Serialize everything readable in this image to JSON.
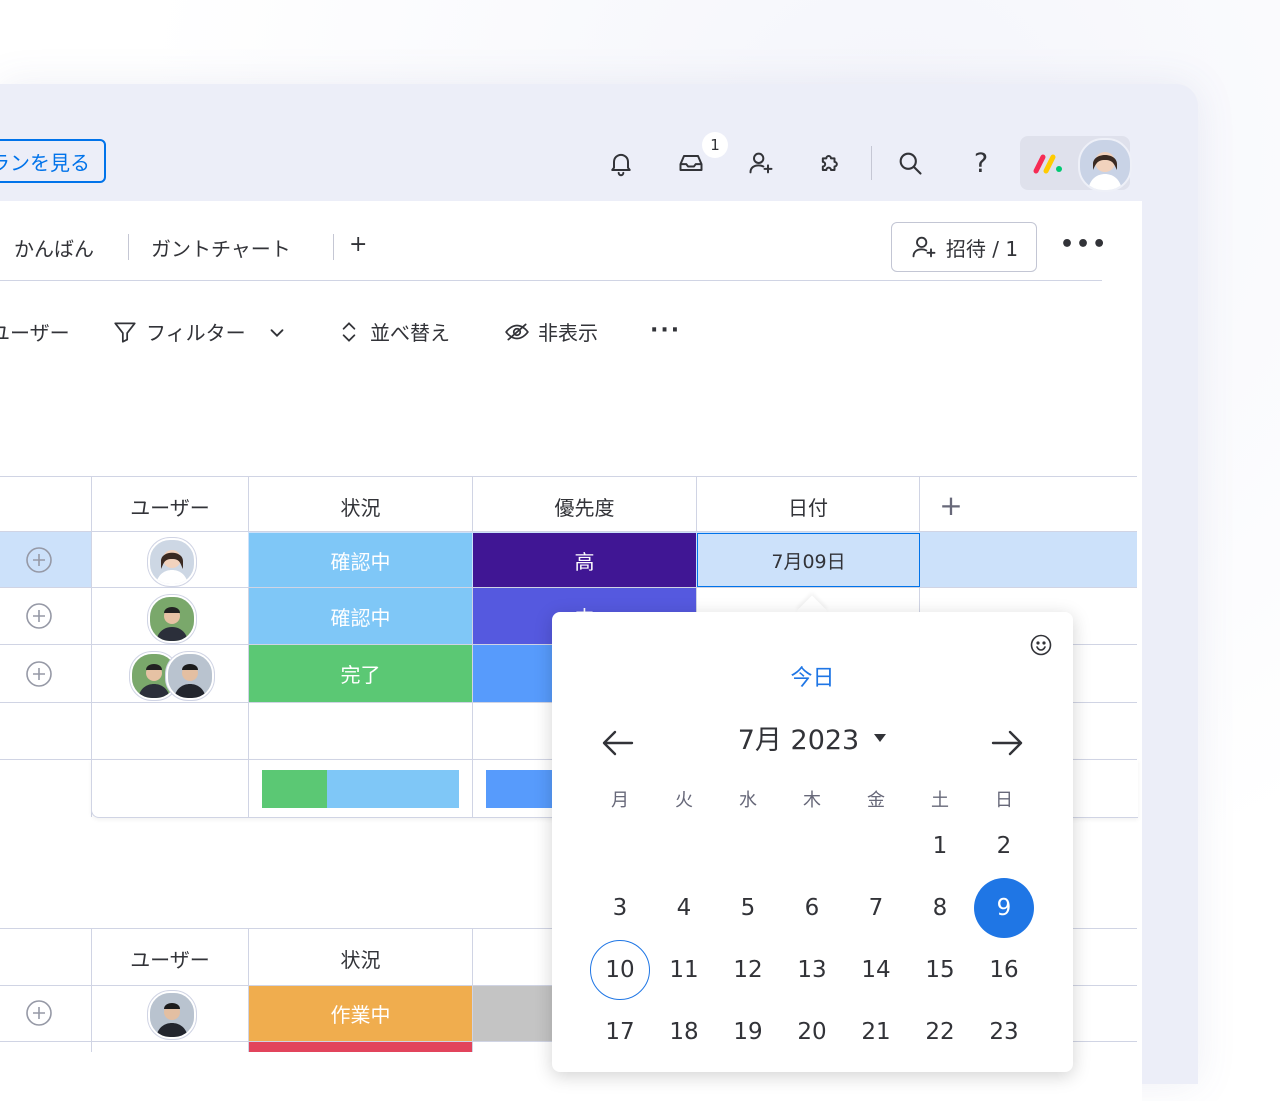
{
  "topbar": {
    "see_plans_label": "ランを見る",
    "notification_badge": "1",
    "icons": [
      "bell-icon",
      "inbox-icon",
      "invite-user-icon",
      "apps-puzzle-icon",
      "search-icon",
      "help-icon"
    ]
  },
  "tabs": {
    "items": [
      "かんばん",
      "ガントチャート",
      "+"
    ],
    "invite_label": "招待 / 1",
    "more": "•••"
  },
  "toolbar": {
    "user_label": "ユーザー",
    "filter_label": "フィルター",
    "sort_label": "並べ替え",
    "hide_label": "非表示",
    "more": "···"
  },
  "table1": {
    "headers": {
      "user": "ユーザー",
      "status": "状況",
      "priority": "優先度",
      "date": "日付",
      "add": "+"
    },
    "rows": [
      {
        "status": "確認中",
        "status_color": "#7fc7f7",
        "priority": "高",
        "priority_color": "#401694",
        "date": "7月09日"
      },
      {
        "status": "確認中",
        "status_color": "#7fc7f7",
        "priority": "中",
        "priority_color": "#5559df",
        "date": ""
      },
      {
        "status": "完了",
        "status_color": "#5bc874",
        "priority": "",
        "priority_color": "#579bfc",
        "date": ""
      }
    ],
    "summary": {
      "status_colors": [
        "#5bc874",
        "#7fc7f7"
      ],
      "status_split": [
        0.33,
        0.67
      ],
      "priority_color": "#579bfc"
    }
  },
  "table2": {
    "headers": {
      "user": "ユーザー",
      "status": "状況"
    },
    "rows": [
      {
        "status": "作業中",
        "status_color": "#f0ad4e"
      }
    ]
  },
  "calendar": {
    "today_label": "今日",
    "month_label": "7月 2023",
    "weekdays": [
      "月",
      "火",
      "水",
      "木",
      "金",
      "土",
      "日"
    ],
    "weeks": [
      [
        "",
        "",
        "",
        "",
        "",
        "1",
        "2"
      ],
      [
        "3",
        "4",
        "5",
        "6",
        "7",
        "8",
        "9"
      ],
      [
        "10",
        "11",
        "12",
        "13",
        "14",
        "15",
        "16"
      ],
      [
        "17",
        "18",
        "19",
        "20",
        "21",
        "22",
        "23"
      ]
    ],
    "selected_day": "9",
    "today_day": "10",
    "accent": "#1f76e5"
  }
}
